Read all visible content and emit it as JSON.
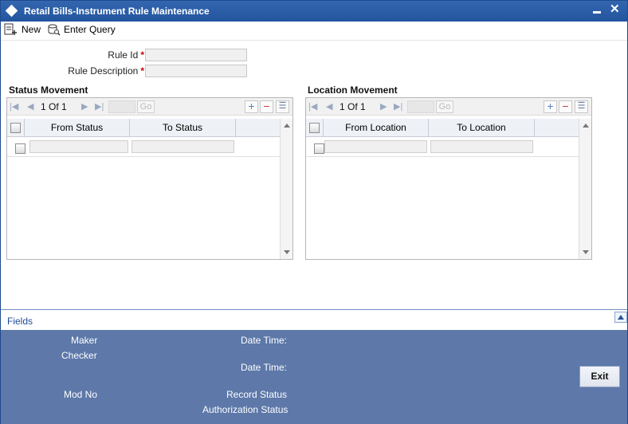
{
  "window": {
    "title": "Retail Bills-Instrument Rule Maintenance"
  },
  "toolbar": {
    "new_label": "New",
    "enter_query_label": "Enter Query"
  },
  "form": {
    "rule_id_label": "Rule Id",
    "rule_id_value": "",
    "rule_description_label": "Rule Description",
    "rule_description_value": "",
    "required_marker": "*"
  },
  "status_movement": {
    "title": "Status Movement",
    "page": "1",
    "of_label": "Of",
    "total": "1",
    "go_label": "Go",
    "columns": [
      "From Status",
      "To Status"
    ],
    "rows": [
      [
        "",
        ""
      ]
    ]
  },
  "location_movement": {
    "title": "Location Movement",
    "page": "1",
    "of_label": "Of",
    "total": "1",
    "go_label": "Go",
    "columns": [
      "From Location",
      "To Location"
    ],
    "rows": [
      [
        "",
        ""
      ]
    ]
  },
  "fields_bar": {
    "label": "Fields"
  },
  "audit": {
    "maker_label": "Maker",
    "checker_label": "Checker",
    "date_time_label_1": "Date Time:",
    "date_time_label_2": "Date Time:",
    "mod_no_label": "Mod No",
    "record_status_label": "Record Status",
    "authorization_status_label": "Authorization Status",
    "exit_label": "Exit"
  },
  "colors": {
    "title_bar": "#23559f",
    "audit_panel": "#5d78a9",
    "required": "#c00000",
    "link": "#1f4a9c"
  },
  "icons": [
    "diamond-icon",
    "minimize-icon",
    "close-icon",
    "new-document-icon",
    "enter-query-icon",
    "first-page-icon",
    "prev-page-icon",
    "next-page-icon",
    "last-page-icon",
    "add-row-icon",
    "delete-row-icon",
    "single-record-view-icon",
    "scroll-up-icon",
    "scroll-down-icon",
    "collapse-up-icon"
  ]
}
